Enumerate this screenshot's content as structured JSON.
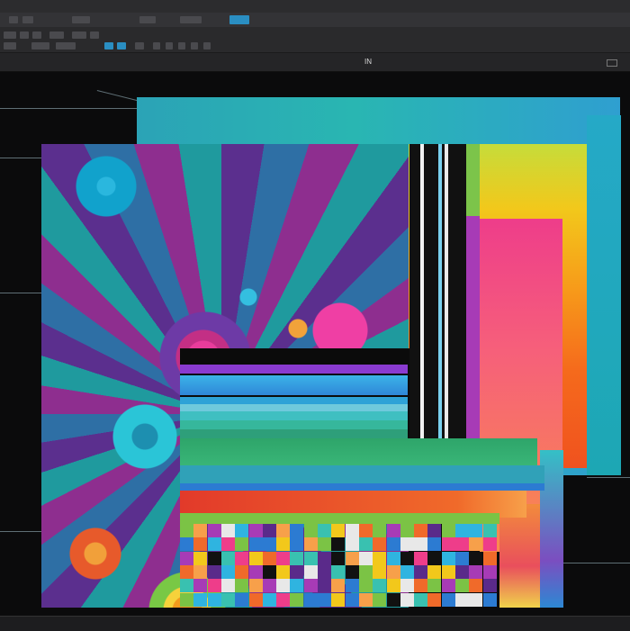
{
  "menubar": {
    "items": [
      "",
      "",
      "",
      "",
      "",
      "",
      "",
      "",
      "",
      "",
      "",
      "",
      ""
    ]
  },
  "document": {
    "tab_label": "IN"
  },
  "colors": {
    "ui_dark": "#0b0b0c",
    "panel": "#2a2a2c",
    "accent": "#2a8ec2",
    "teal": "#2ba3b6",
    "magenta": "#ee3d8a",
    "orange": "#f56a1c",
    "yellow": "#f2c81b",
    "purple": "#a73bb6",
    "green": "#39b577",
    "red": "#e23a2a"
  },
  "icons": {
    "toolbar": [
      "move-icon",
      "marquee-icon",
      "lasso-icon",
      "crop-icon",
      "brush-icon",
      "eraser-icon",
      "gradient-icon",
      "type-icon",
      "zoom-icon"
    ],
    "window": "restore-window-icon"
  },
  "canvas": {
    "layers": [
      "floral-pattern-layer",
      "teal-layer",
      "gradient-layer",
      "pink-layer",
      "stripe-bars-layer",
      "color-grid-layer"
    ]
  }
}
